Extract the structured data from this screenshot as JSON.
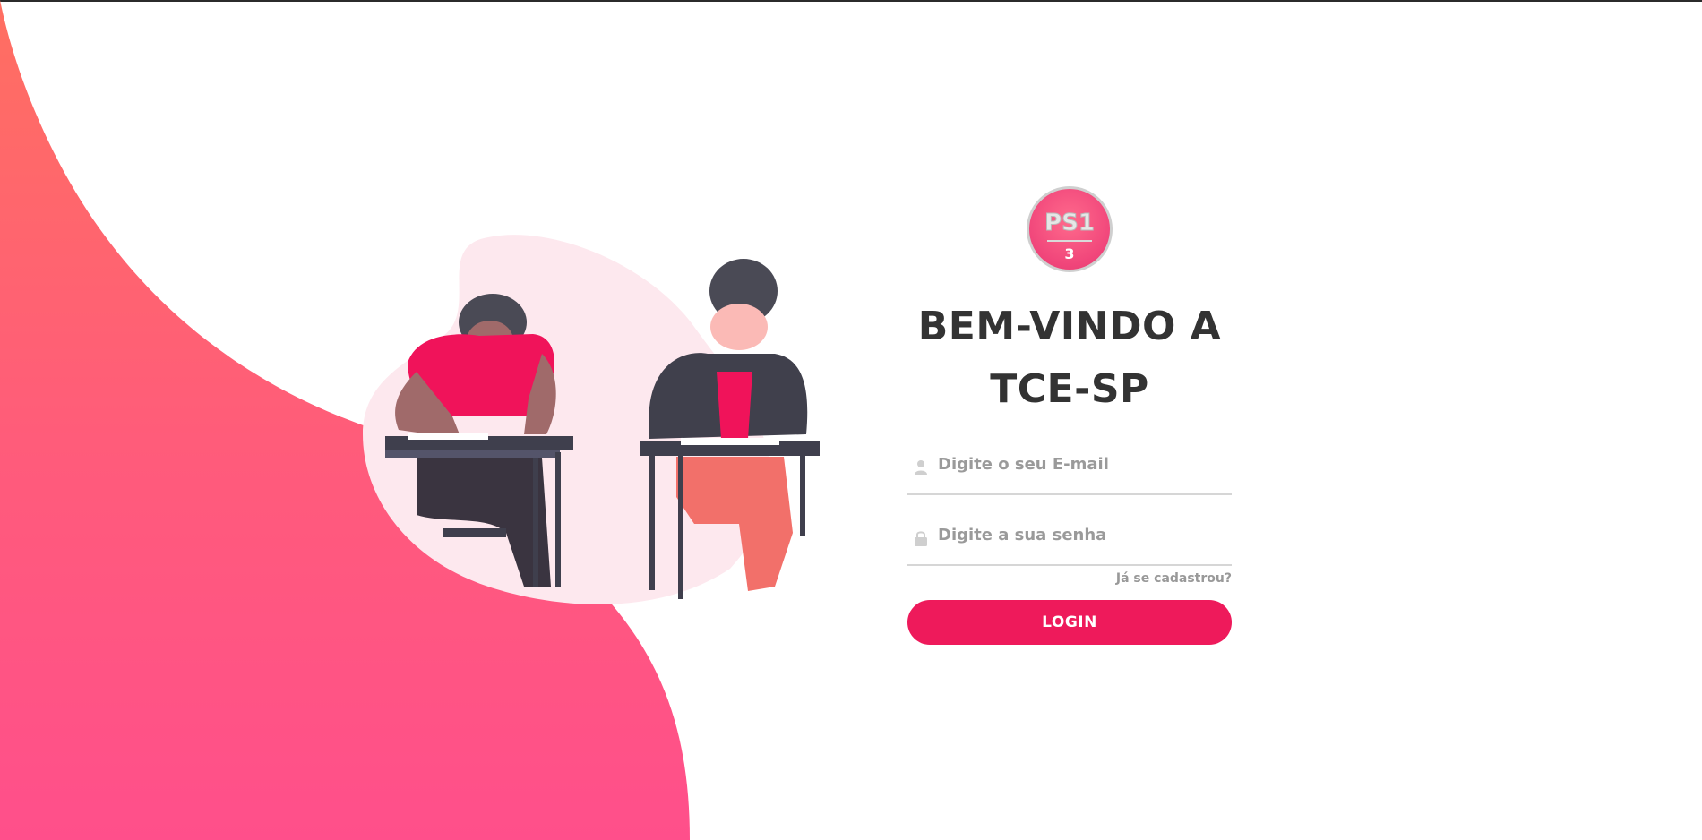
{
  "brand": {
    "logo_text": "PS1",
    "logo_subtext": "3",
    "logo_color": "#f0457a"
  },
  "colors": {
    "accent": "#ee1a5b",
    "wave_top": "#ff6f61",
    "wave_bottom": "#ff4f8b",
    "blob": "#fde8ee"
  },
  "login": {
    "title_line1": "BEM-VINDO A",
    "title_line2": "TCE-SP",
    "email_placeholder": "Digite o seu E-mail",
    "email_icon": "user-icon",
    "password_placeholder": "Digite a sua senha",
    "password_icon": "lock-icon",
    "forgot_label": "Já se cadastrou?",
    "submit_label": "LOGIN"
  }
}
